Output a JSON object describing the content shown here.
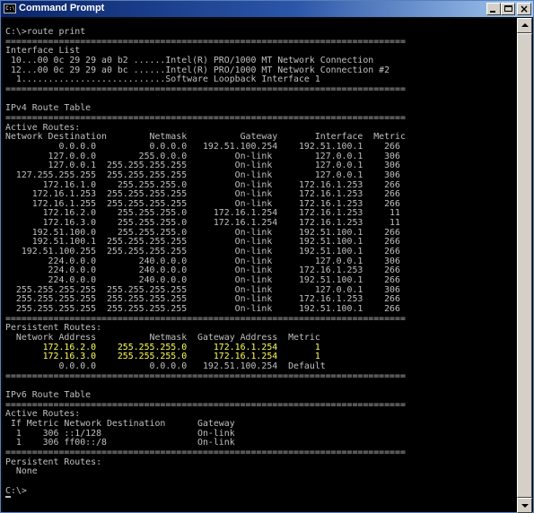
{
  "window": {
    "title": "Command Prompt",
    "icon_name": "cmd-window-icon",
    "icon_text": "C:\\",
    "accent_color": "#0a246a",
    "highlight_color": "#ffff55"
  },
  "console": {
    "lines": [
      "C:\\>route print",
      "===========================================================================",
      "Interface List",
      " 10...00 0c 29 29 a0 b2 ......Intel(R) PRO/1000 MT Network Connection",
      " 12...00 0c 29 29 a0 bc ......Intel(R) PRO/1000 MT Network Connection #2",
      "  1...........................Software Loopback Interface 1",
      "===========================================================================",
      "",
      "IPv4 Route Table",
      "===========================================================================",
      "Active Routes:",
      "Network Destination        Netmask          Gateway       Interface  Metric",
      "          0.0.0.0          0.0.0.0   192.51.100.254    192.51.100.1    266",
      "        127.0.0.0        255.0.0.0         On-link        127.0.0.1    306",
      "        127.0.0.1  255.255.255.255         On-link        127.0.0.1    306",
      "  127.255.255.255  255.255.255.255         On-link        127.0.0.1    306",
      "       172.16.1.0    255.255.255.0         On-link     172.16.1.253    266",
      "     172.16.1.253  255.255.255.255         On-link     172.16.1.253    266",
      "     172.16.1.255  255.255.255.255         On-link     172.16.1.253    266",
      "       172.16.2.0    255.255.255.0     172.16.1.254    172.16.1.253     11",
      "       172.16.3.0    255.255.255.0     172.16.1.254    172.16.1.253     11",
      "     192.51.100.0    255.255.255.0         On-link     192.51.100.1    266",
      "     192.51.100.1  255.255.255.255         On-link     192.51.100.1    266",
      "   192.51.100.255  255.255.255.255         On-link     192.51.100.1    266",
      "        224.0.0.0        240.0.0.0         On-link        127.0.0.1    306",
      "        224.0.0.0        240.0.0.0         On-link     172.16.1.253    266",
      "        224.0.0.0        240.0.0.0         On-link     192.51.100.1    266",
      "  255.255.255.255  255.255.255.255         On-link        127.0.0.1    306",
      "  255.255.255.255  255.255.255.255         On-link     172.16.1.253    266",
      "  255.255.255.255  255.255.255.255         On-link     192.51.100.1    266",
      "===========================================================================",
      "Persistent Routes:",
      "  Network Address          Netmask  Gateway Address  Metric",
      "       172.16.2.0    255.255.255.0     172.16.1.254       1",
      "       172.16.3.0    255.255.255.0     172.16.1.254       1",
      "          0.0.0.0          0.0.0.0   192.51.100.254  Default",
      "===========================================================================",
      "",
      "IPv6 Route Table",
      "===========================================================================",
      "Active Routes:",
      " If Metric Network Destination      Gateway",
      "  1    306 ::1/128                  On-link",
      "  1    306 ff00::/8                 On-link",
      "===========================================================================",
      "Persistent Routes:",
      "  None",
      "",
      "C:\\>"
    ]
  }
}
